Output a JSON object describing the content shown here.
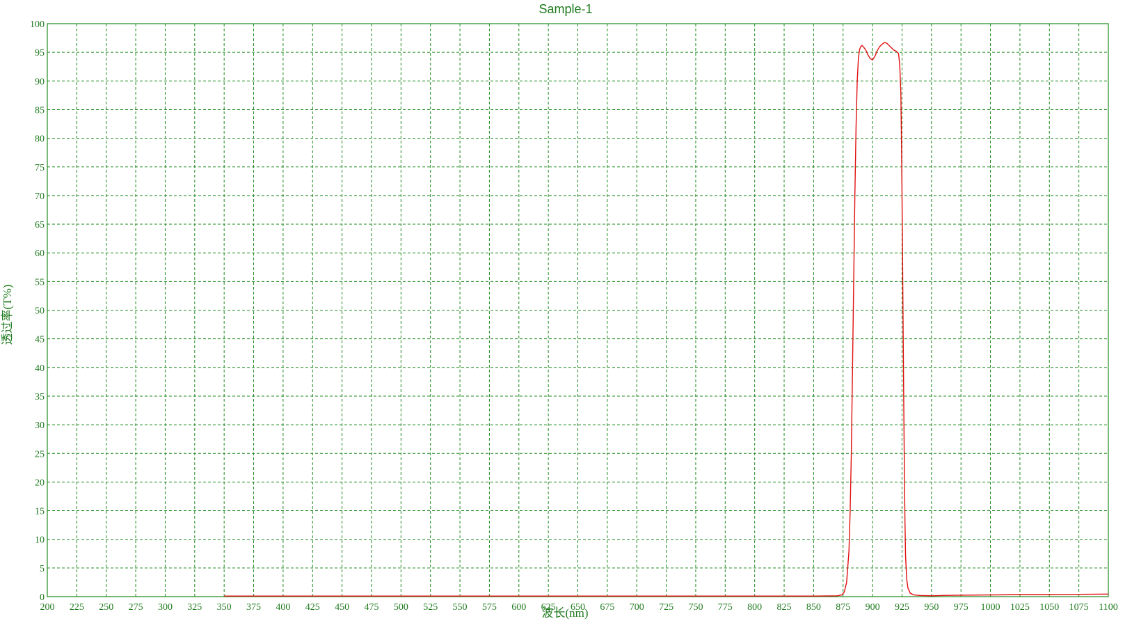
{
  "chart_data": {
    "type": "line",
    "title": "Sample-1",
    "xlabel": "波长(nm)",
    "ylabel": "透过率(T%)",
    "xlim": [
      200,
      1100
    ],
    "ylim": [
      0,
      100
    ],
    "x_ticks": [
      200,
      225,
      250,
      275,
      300,
      325,
      350,
      375,
      400,
      425,
      450,
      475,
      500,
      525,
      550,
      575,
      600,
      625,
      650,
      675,
      700,
      725,
      750,
      775,
      800,
      825,
      850,
      875,
      900,
      925,
      950,
      975,
      1000,
      1025,
      1050,
      1075,
      1100
    ],
    "y_ticks": [
      0,
      5,
      10,
      15,
      20,
      25,
      30,
      35,
      40,
      45,
      50,
      55,
      60,
      65,
      70,
      75,
      80,
      85,
      90,
      95,
      100
    ],
    "grid": true,
    "legend": "none",
    "series": [
      {
        "color": "#e01010",
        "x": [
          350,
          400,
          500,
          600,
          700,
          800,
          850,
          870,
          874,
          876,
          878,
          880,
          881,
          882,
          883,
          884,
          885,
          886,
          887,
          888,
          889,
          890,
          891,
          892,
          894,
          896,
          898,
          900,
          902,
          904,
          906,
          908,
          910,
          912,
          914,
          916,
          918,
          920,
          922,
          923,
          924,
          924.5,
          925,
          925.5,
          926,
          926.5,
          927,
          927.5,
          928,
          929,
          930,
          932,
          935,
          940,
          950,
          960,
          975,
          1000,
          1025,
          1050,
          1075,
          1100
        ],
        "values": [
          0.1,
          0.1,
          0.1,
          0.1,
          0.1,
          0.1,
          0.1,
          0.15,
          0.3,
          0.8,
          2.5,
          8,
          15,
          25,
          40,
          55,
          70,
          82,
          90,
          94,
          95.5,
          96,
          96.2,
          96.0,
          95.5,
          94.6,
          93.9,
          93.7,
          94.3,
          95.3,
          96.0,
          96.4,
          96.7,
          96.6,
          96.2,
          95.8,
          95.4,
          95.2,
          94.8,
          93,
          88,
          80,
          70,
          58,
          45,
          33,
          22,
          13,
          7,
          3,
          1.5,
          0.6,
          0.3,
          0.2,
          0.15,
          0.2,
          0.25,
          0.3,
          0.35,
          0.35,
          0.4,
          0.45
        ]
      }
    ],
    "colors": {
      "grid": "#1e8a1e",
      "axis": "#1e7a1e",
      "text": "#1e7a1e",
      "line": "#e01010",
      "background": "#ffffff"
    }
  }
}
